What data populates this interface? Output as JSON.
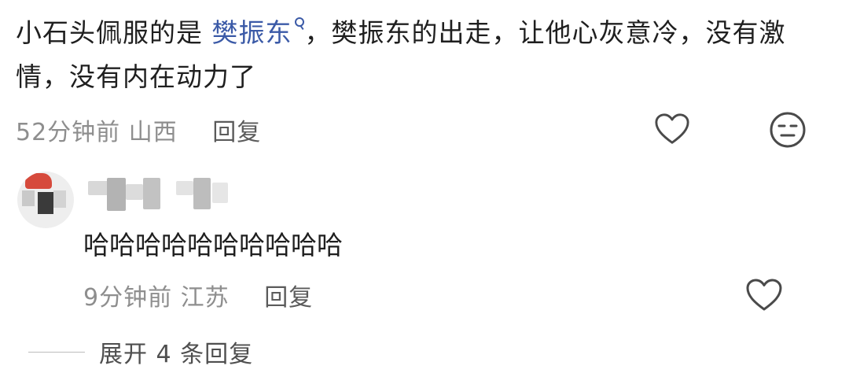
{
  "comment": {
    "text_before": "小石头佩服的是 ",
    "topic_link": "樊振东",
    "text_after": "，樊振东的出走，让他心灰意冷，没有激情，没有内在动力了",
    "time": "52分钟前",
    "location": "山西",
    "reply_label": "回复",
    "icons": [
      "heart-outline-icon",
      "neutral-face-icon",
      "search-icon"
    ]
  },
  "reply": {
    "text": "哈哈哈哈哈哈哈哈哈哈",
    "time": "9分钟前",
    "location": "江苏",
    "reply_label": "回复",
    "icons": [
      "heart-outline-icon"
    ]
  },
  "expand_replies": {
    "label": "展开 4 条回复"
  },
  "colors": {
    "link": "#3b5aa7",
    "text": "#1f1f1f",
    "meta": "#8e8e8e"
  }
}
